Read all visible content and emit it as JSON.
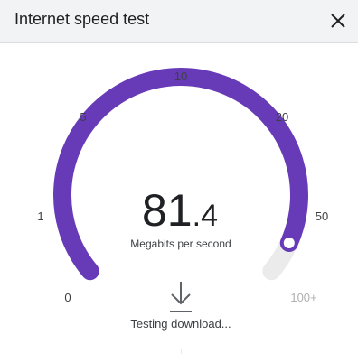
{
  "header": {
    "title": "Internet speed test",
    "close_icon": "close-icon"
  },
  "gauge": {
    "speed_integer": "81",
    "speed_decimal": ".4",
    "unit": "Megabits per second",
    "scale_labels": [
      "0",
      "1",
      "5",
      "10",
      "20",
      "50",
      "100+"
    ],
    "progress": 0.938,
    "track_color": "#673ab7",
    "remaining_color": "#ebebeb"
  },
  "status": {
    "icon": "download-arrow-icon",
    "text": "Testing download..."
  }
}
